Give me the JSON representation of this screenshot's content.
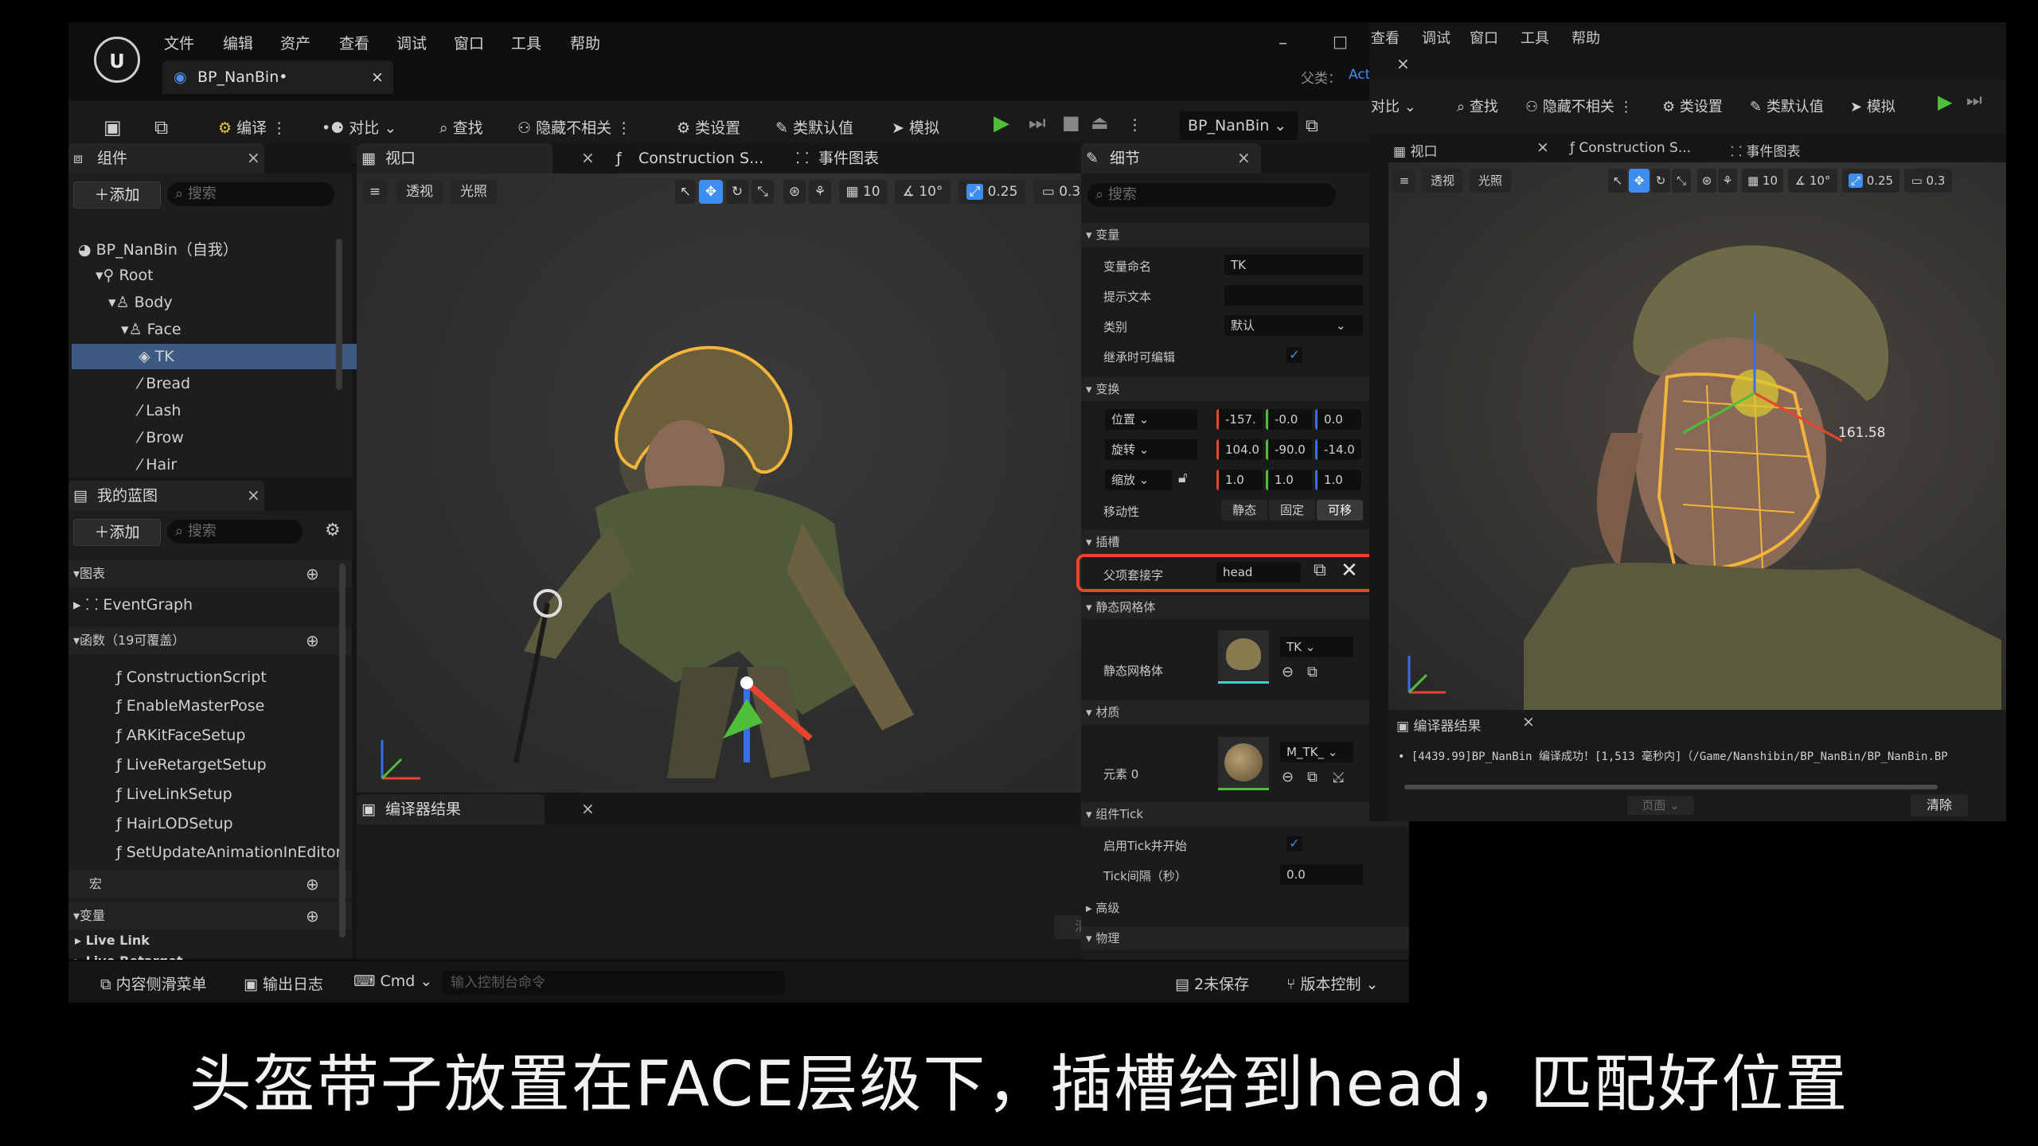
{
  "menus": [
    "文件",
    "编辑",
    "资产",
    "查看",
    "调试",
    "窗口",
    "工具",
    "帮助"
  ],
  "logo_text": "U",
  "doc_tab": "BP_NanBin•",
  "parent_label": "父类：",
  "parent_value": "Act",
  "toolbar": {
    "compile": "编译",
    "diff": "对比",
    "find": "查找",
    "hide_unrelated": "隐藏不相关",
    "class_settings": "类设置",
    "class_defaults": "类默认值",
    "simulate": "模拟",
    "debug_object": "BP_NanBin"
  },
  "components": {
    "tab": "组件",
    "add": "＋添加",
    "search_placeholder": "搜索",
    "tree": [
      {
        "label": "BP_NanBin（自我）"
      },
      {
        "label": "Root"
      },
      {
        "label": "Body"
      },
      {
        "label": "Face"
      },
      {
        "label": "TK"
      },
      {
        "label": "Bread"
      },
      {
        "label": "Lash"
      },
      {
        "label": "Brow"
      },
      {
        "label": "Hair"
      }
    ]
  },
  "my_blueprint": {
    "tab": "我的蓝图",
    "add": "＋添加",
    "search_placeholder": "搜索",
    "graphs_section": "图表",
    "event_graph": "EventGraph",
    "functions_section": "函数（19可覆盖）",
    "functions": [
      "ConstructionScript",
      "EnableMasterPose",
      "ARKitFaceSetup",
      "LiveRetargetSetup",
      "LiveLinkSetup",
      "HairLODSetup",
      "SetUpdateAnimationInEditor"
    ],
    "macros_section": "宏",
    "variables_section": "变量",
    "var_groups": [
      "Live Link",
      "Live Retarget"
    ]
  },
  "viewport": {
    "tab": "视口",
    "construction_tab": "Construction S...",
    "event_graph_tab": "事件图表",
    "perspective": "透视",
    "lit": "光照",
    "grid": "10",
    "angle": "10°",
    "scale": "0.25",
    "camera_speed": "0.3"
  },
  "compiler_results": {
    "tab": "编译器结果",
    "clear": "清除"
  },
  "details": {
    "tab": "细节",
    "search_placeholder": "搜索",
    "variable_section": "变量",
    "var_name_label": "变量命名",
    "var_name_value": "TK",
    "tooltip_label": "提示文本",
    "category_label": "类别",
    "category_value": "默认",
    "editable_label": "继承时可编辑",
    "transform_section": "变换",
    "location_label": "位置",
    "location": [
      "-157.",
      "-0.0",
      "0.0"
    ],
    "rotation_label": "旋转",
    "rotation": [
      "104.0",
      "-90.0",
      "-14.0"
    ],
    "scale_label": "缩放",
    "scale": [
      "1.0",
      "1.0",
      "1.0"
    ],
    "mobility_label": "移动性",
    "mobility": [
      "静态",
      "固定",
      "可移"
    ],
    "sockets_section": "插槽",
    "parent_socket_label": "父项套接字",
    "parent_socket_value": "head",
    "static_mesh_section": "静态网格体",
    "static_mesh_label": "静态网格体",
    "static_mesh_value": "TK",
    "materials_section": "材质",
    "element0_label": "元素 0",
    "element0_value": "M_TK_",
    "tick_section": "组件Tick",
    "tick_start_label": "启用Tick并开始",
    "tick_interval_label": "Tick间隔（秒）",
    "tick_interval_value": "0.0",
    "advanced_section": "高级",
    "physics_section": "物理"
  },
  "statusbar": {
    "content_drawer": "内容侧滑菜单",
    "output_log": "输出日志",
    "cmd": "Cmd",
    "console_placeholder": "输入控制台命令",
    "unsaved": "2未保存",
    "source_control": "版本控制"
  },
  "inset": {
    "menus": [
      "查看",
      "调试",
      "窗口",
      "工具",
      "帮助"
    ],
    "toolbar": {
      "diff": "对比",
      "find": "查找",
      "hide_unrelated": "隐藏不相关",
      "class_settings": "类设置",
      "class_defaults": "类默认值",
      "simulate": "模拟"
    },
    "viewport_tab": "视口",
    "construction_tab": "Construction S...",
    "event_graph_tab": "事件图表",
    "perspective": "透视",
    "lit": "光照",
    "grid": "10",
    "angle": "10°",
    "scale": "0.25",
    "camera_speed": "0.3",
    "measure": "161.58",
    "compiler_tab": "编译器结果",
    "log_line": "[4439.99]BP_NanBin 编译成功！[1,513 毫秒内]（/Game/Nanshibin/BP_NanBin/BP_NanBin.BP",
    "page_label": "页面",
    "clear": "清除"
  },
  "subtitle": "头盔带子放置在FACE层级下，插槽给到head，匹配好位置",
  "colors": {
    "accent": "#3d8ef0",
    "highlight": "#e8432e",
    "selection": "#3c5a82",
    "play": "#4fbf3a",
    "helmet_outline": "#f2b43a"
  }
}
